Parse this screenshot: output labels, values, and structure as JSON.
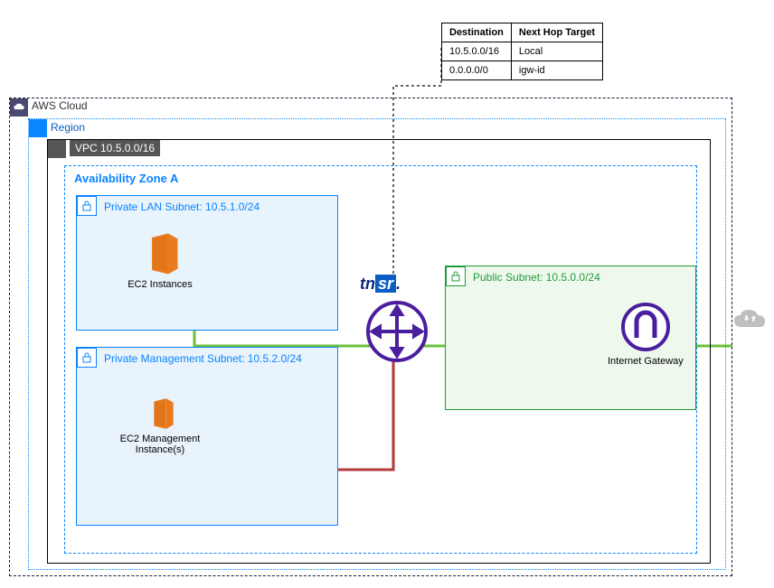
{
  "routeTable": {
    "headers": {
      "dest": "Destination",
      "next": "Next Hop Target"
    },
    "rows": [
      {
        "dest": "10.5.0.0/16",
        "next": "Local"
      },
      {
        "dest": "0.0.0.0/0",
        "next": "igw-id"
      }
    ]
  },
  "cloud": {
    "label": "AWS Cloud"
  },
  "region": {
    "label": "Region"
  },
  "vpc": {
    "label": "VPC 10.5.0.0/16"
  },
  "az": {
    "label": "Availability Zone A"
  },
  "subnets": {
    "privateLan": {
      "label": "Private LAN Subnet: 10.5.1.0/24"
    },
    "privateMgmt": {
      "label": "Private Management Subnet: 10.5.2.0/24"
    },
    "public": {
      "label": "Public Subnet: 10.5.0.0/24"
    }
  },
  "ec2": {
    "private": {
      "caption": "EC2 Instances"
    },
    "mgmt": {
      "caption": "EC2 Management Instance(s)"
    }
  },
  "router": {
    "brand_tn": "tn",
    "brand_sr": "sr"
  },
  "igw": {
    "caption": "Internet Gateway"
  },
  "colors": {
    "privateBlue": "#0a84ff",
    "publicGreen": "#1f9d3a",
    "routerPurple": "#4b1e9e",
    "lanLine": "#6cbf3a",
    "mgmtLine": "#b53a3a",
    "wanLine": "#6cbf3a"
  }
}
